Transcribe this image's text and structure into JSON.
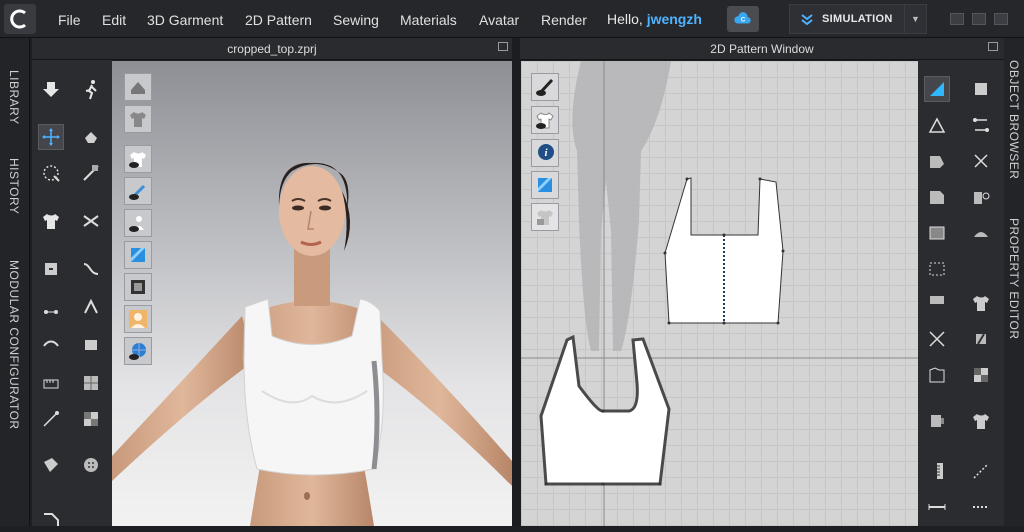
{
  "menu": {
    "items": [
      "File",
      "Edit",
      "3D Garment",
      "2D Pattern",
      "Sewing",
      "Materials",
      "Avatar",
      "Render"
    ],
    "greeting": "Hello,",
    "username": "jwengzh"
  },
  "simulation": {
    "label": "SIMULATION"
  },
  "side_left": {
    "tabs": [
      "LIBRARY",
      "HISTORY",
      "MODULAR CONFIGURATOR"
    ]
  },
  "side_right": {
    "tabs": [
      "OBJECT BROWSER",
      "PROPERTY EDITOR"
    ]
  },
  "panels": {
    "left_title": "cropped_top.zprj",
    "right_title": "2D Pattern Window"
  },
  "colors": {
    "accent": "#4fb3ff",
    "background": "#1e1f22",
    "pattern_fill": "#ffffff",
    "grid": "#d4d4d4"
  },
  "icons": {
    "tools_3d": [
      "arrow-down-icon",
      "walk-icon",
      "move-gizmo-icon",
      "hand-icon",
      "transform-icon",
      "needle-icon",
      "garment-select-icon",
      "scissor-icon",
      "edit-avatar-icon",
      "line-icon",
      "pin-icon",
      "fold-icon",
      "sewing-icon",
      "tape-icon",
      "measure-icon",
      "texture-icon",
      "fabric-icon",
      "draw-icon",
      "spring-icon",
      "button-icon",
      "puckering-icon",
      "rotate-icon"
    ],
    "tools_2d": [
      "triangle-select-icon",
      "pattern-select-icon",
      "polygon-icon",
      "pattern-edit-icon",
      "rectangle-icon",
      "segment-sew-icon",
      "dart-icon",
      "free-sew-icon",
      "internal-shape-icon",
      "seam-icon",
      "topstitch-icon",
      "trim-icon",
      "pin-2d-icon",
      "fold-arrange-icon"
    ]
  }
}
